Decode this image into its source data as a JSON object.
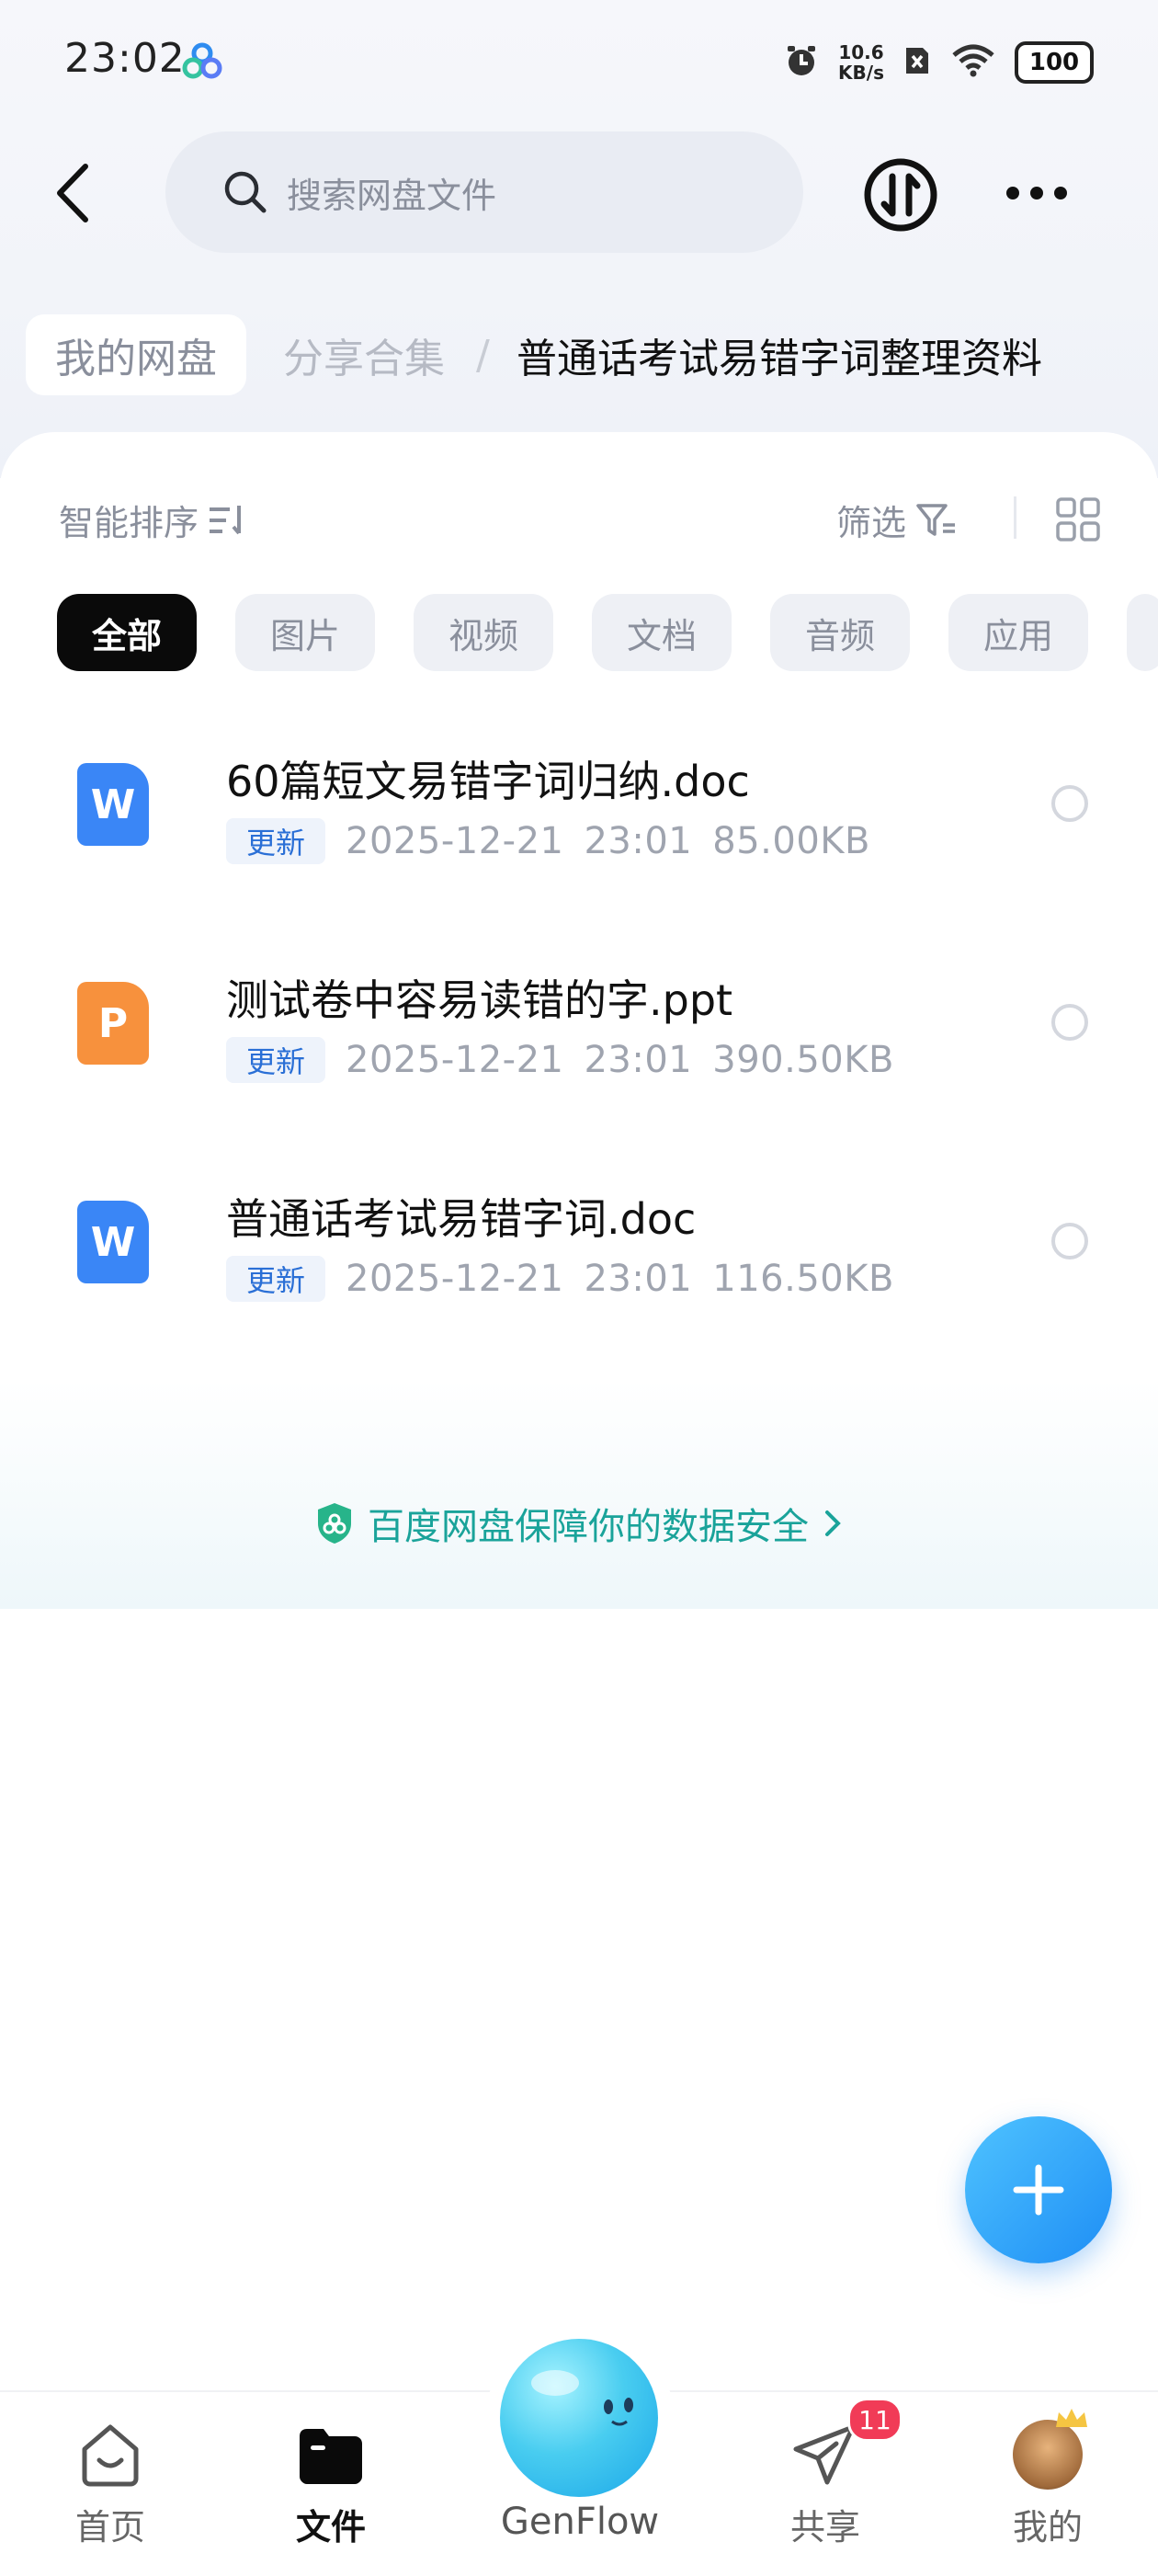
{
  "status_bar": {
    "time": "23:02",
    "net_speed_value": "10.6",
    "net_speed_unit": "KB/s",
    "battery": "100"
  },
  "header": {
    "search_placeholder": "搜索网盘文件"
  },
  "breadcrumb": {
    "root": "我的网盘",
    "middle": "分享合集",
    "separator": "/",
    "current": "普通话考试易错字词整理资料"
  },
  "toolbar": {
    "sort_label": "智能排序",
    "filter_label": "筛选"
  },
  "tabs": [
    {
      "label": "全部",
      "active": true
    },
    {
      "label": "图片",
      "active": false
    },
    {
      "label": "视频",
      "active": false
    },
    {
      "label": "文档",
      "active": false
    },
    {
      "label": "音频",
      "active": false
    },
    {
      "label": "应用",
      "active": false
    }
  ],
  "files": [
    {
      "name": "60篇短文易错字词归纳.doc",
      "badge": "更新",
      "date": "2025-12-21",
      "time": "23:01",
      "size": "85.00KB",
      "type": "word",
      "icon_letter": "W"
    },
    {
      "name": "测试卷中容易读错的字.ppt",
      "badge": "更新",
      "date": "2025-12-21",
      "time": "23:01",
      "size": "390.50KB",
      "type": "ppt",
      "icon_letter": "P"
    },
    {
      "name": "普通话考试易错字词.doc",
      "badge": "更新",
      "date": "2025-12-21",
      "time": "23:01",
      "size": "116.50KB",
      "type": "word",
      "icon_letter": "W"
    }
  ],
  "security_banner": {
    "text": "百度网盘保障你的数据安全"
  },
  "bottom_nav": {
    "home": "首页",
    "files": "文件",
    "genflow": "GenFlow",
    "share": "共享",
    "share_badge": "11",
    "mine": "我的"
  },
  "colors": {
    "accent_blue": "#1e8ef5",
    "word_blue": "#3a86f6",
    "ppt_orange": "#f7913d",
    "security_green": "#1aa39a",
    "badge_red": "#f13b57"
  }
}
